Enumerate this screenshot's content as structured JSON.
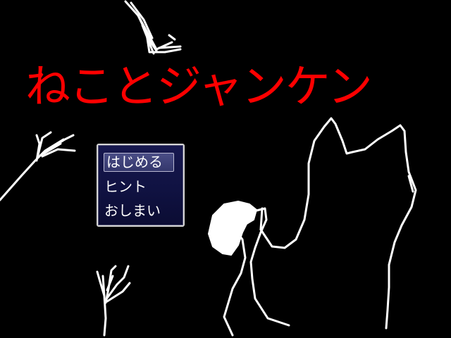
{
  "game": {
    "title": "ねことジャンケン"
  },
  "menu": {
    "items": [
      {
        "label": "はじめる",
        "selected": true
      },
      {
        "label": "ヒント",
        "selected": false
      },
      {
        "label": "おしまい",
        "selected": false
      }
    ]
  },
  "colors": {
    "background": "#000000",
    "title": "#ff0000",
    "line_art": "#ffffff",
    "window_fill": "#101242",
    "window_border": "#d6d6d6",
    "cursor_fill": "#3e4178"
  },
  "icons": {
    "cat": "cat-silhouette-icon",
    "feathers": "feather-toy-icon"
  }
}
